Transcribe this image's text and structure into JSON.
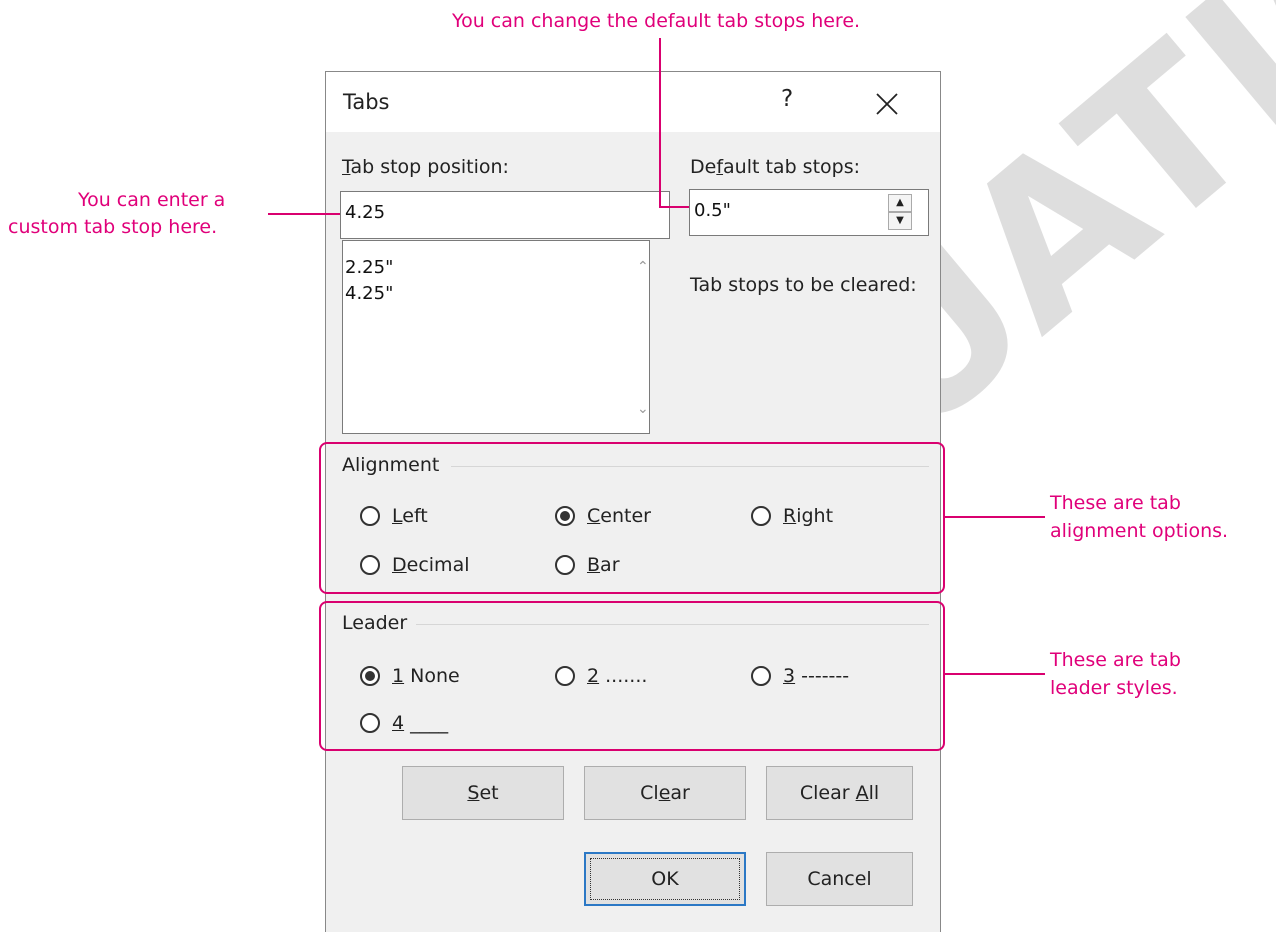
{
  "dialog": {
    "title": "Tabs",
    "help_glyph": "?",
    "tab_stop_label_pre": "",
    "tab_stop_label_key": "T",
    "tab_stop_label_post": "ab stop position:",
    "tab_stop_value": "4.25",
    "tab_stop_list": [
      "2.25\"",
      "4.25\""
    ],
    "default_label_pre": "De",
    "default_label_key": "f",
    "default_label_post": "ault tab stops:",
    "default_value": "0.5\"",
    "to_be_cleared_label": "Tab stops to be cleared:",
    "alignment": {
      "group_label": "Alignment",
      "options": [
        {
          "key": "L",
          "rest": "eft",
          "selected": false
        },
        {
          "key": "C",
          "rest": "enter",
          "selected": true
        },
        {
          "key": "R",
          "rest": "ight",
          "selected": false
        },
        {
          "key": "D",
          "rest": "ecimal",
          "selected": false
        },
        {
          "key": "B",
          "rest": "ar",
          "selected": false
        }
      ]
    },
    "leader": {
      "group_label": "Leader",
      "options": [
        {
          "key": "1",
          "rest": " None",
          "selected": true
        },
        {
          "key": "2",
          "rest": " .......",
          "selected": false
        },
        {
          "key": "3",
          "rest": " -------",
          "selected": false
        },
        {
          "key": "4",
          "rest": " ____",
          "selected": false
        }
      ]
    },
    "buttons": {
      "set_key": "S",
      "set_rest": "et",
      "clear_pre": "Cl",
      "clear_key": "e",
      "clear_post": "ar",
      "clear_all_pre": "Clear ",
      "clear_all_key": "A",
      "clear_all_post": "ll",
      "ok": "OK",
      "cancel": "Cancel"
    }
  },
  "callouts": {
    "default_tab_stops": "You can change the default tab stops here.",
    "custom_tab_stop_line1": "You can enter a",
    "custom_tab_stop_line2": "custom tab stop here.",
    "alignment_line1": "These are tab",
    "alignment_line2": "alignment options.",
    "leader_line1": "These are tab",
    "leader_line2": "leader styles."
  },
  "watermark": "EVALUATION ONLY",
  "colors": {
    "callout": "#e0007a",
    "default_button_border": "#2b78c5"
  }
}
